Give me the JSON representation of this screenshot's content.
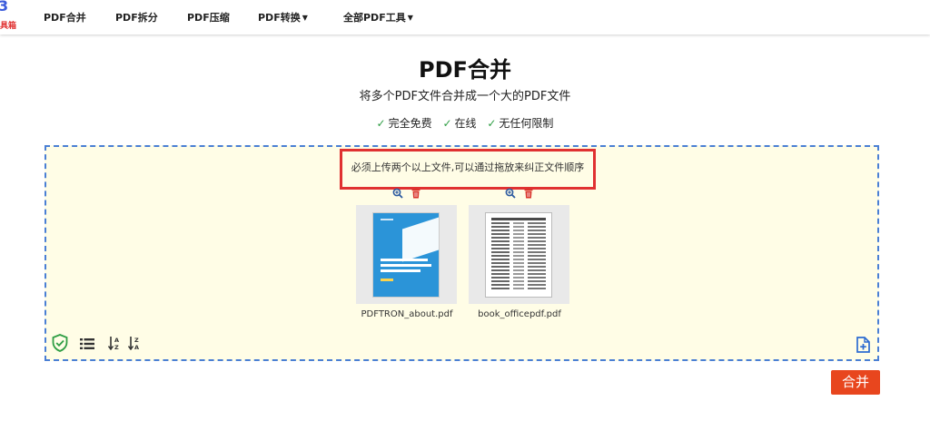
{
  "logo": {
    "mark": "3",
    "text": "具箱"
  },
  "nav": {
    "items": [
      {
        "label": "PDF合并",
        "dropdown": false
      },
      {
        "label": "PDF拆分",
        "dropdown": false
      },
      {
        "label": "PDF压缩",
        "dropdown": false
      },
      {
        "label": "PDF转换",
        "dropdown": true
      },
      {
        "label": "全部PDF工具",
        "dropdown": true
      }
    ]
  },
  "hero": {
    "title": "PDF合并",
    "subtitle": "将多个PDF文件合并成一个大的PDF文件",
    "features": [
      "完全免费",
      "在线",
      "无任何限制"
    ]
  },
  "dropzone": {
    "notice": "必须上传两个以上文件,可以通过拖放来纠正文件顺序",
    "files": [
      {
        "name": "PDFTRON_about.pdf",
        "preview": "blue-cover"
      },
      {
        "name": "book_officepdf.pdf",
        "preview": "table-document"
      }
    ],
    "tools": [
      "shield-check-icon",
      "list-view-icon",
      "sort-az-icon",
      "sort-za-icon",
      "add-file-icon"
    ]
  },
  "actions": {
    "merge_label": "合并"
  },
  "colors": {
    "accent": "#e8461e",
    "dropzone_bg": "#fffde6",
    "dropzone_border": "#4a7fd4",
    "notice_border": "#e03131",
    "check": "#2f9e44"
  }
}
